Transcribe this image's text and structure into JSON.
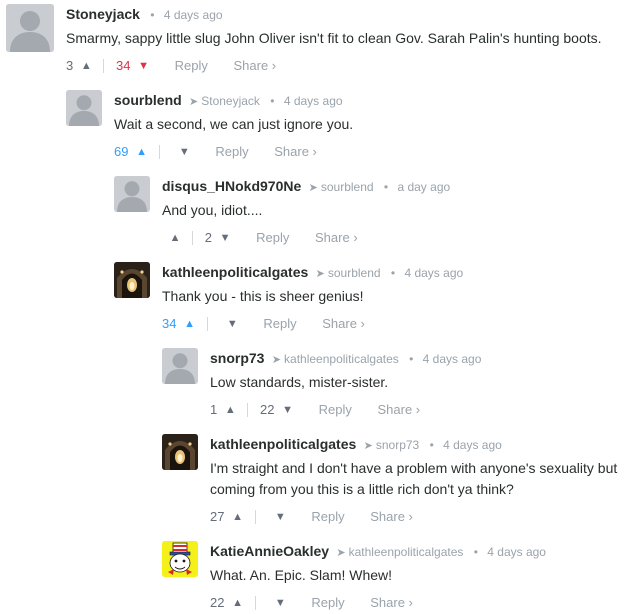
{
  "colors": {
    "text": "#2a2e2e",
    "meta": "#9aa3ab",
    "upvote_active": "#2e9fff",
    "downvote_active": "#e0324b",
    "avatar_placeholder": "#c9cdd1",
    "avatar_cartoon_bg": "#f3f01a"
  },
  "labels": {
    "reply": "Reply",
    "share": "Share ›"
  },
  "comments": [
    {
      "author": "Stoneyjack",
      "reply_to": "",
      "time": "4 days ago",
      "text": "Smarmy, sappy little slug John Oliver isn't fit to clean Gov. Sarah Palin's hunting boots.",
      "upvotes": "3",
      "downvotes": "34",
      "avatar": "placeholder-icon"
    },
    {
      "author": "sourblend",
      "reply_to": "Stoneyjack",
      "time": "4 days ago",
      "text": "Wait a second, we can just ignore you.",
      "upvotes": "69",
      "downvotes": "",
      "avatar": "placeholder-icon"
    },
    {
      "author": "disqus_HNokd970Ne",
      "reply_to": "sourblend",
      "time": "a day ago",
      "text": "And you, idiot....",
      "upvotes": "",
      "downvotes": "2",
      "avatar": "placeholder-icon"
    },
    {
      "author": "kathleenpoliticalgates",
      "reply_to": "sourblend",
      "time": "4 days ago",
      "text": "Thank you - this is sheer genius!",
      "upvotes": "34",
      "downvotes": "",
      "avatar": "tunnel-photo-icon"
    },
    {
      "author": "snorp73",
      "reply_to": "kathleenpoliticalgates",
      "time": "4 days ago",
      "text": "Low standards, mister-sister.",
      "upvotes": "1",
      "downvotes": "22",
      "avatar": "placeholder-icon"
    },
    {
      "author": "kathleenpoliticalgates",
      "reply_to": "snorp73",
      "time": "4 days ago",
      "text": "I'm straight and I don't have a problem with anyone's sexuality but coming from you this is a little rich don't ya think?",
      "upvotes": "27",
      "downvotes": "",
      "avatar": "tunnel-photo-icon"
    },
    {
      "author": "KatieAnnieOakley",
      "reply_to": "kathleenpoliticalgates",
      "time": "4 days ago",
      "text": "What. An. Epic. Slam! Whew!",
      "upvotes": "22",
      "downvotes": "",
      "avatar": "uncle-sam-cartoon-icon"
    }
  ]
}
